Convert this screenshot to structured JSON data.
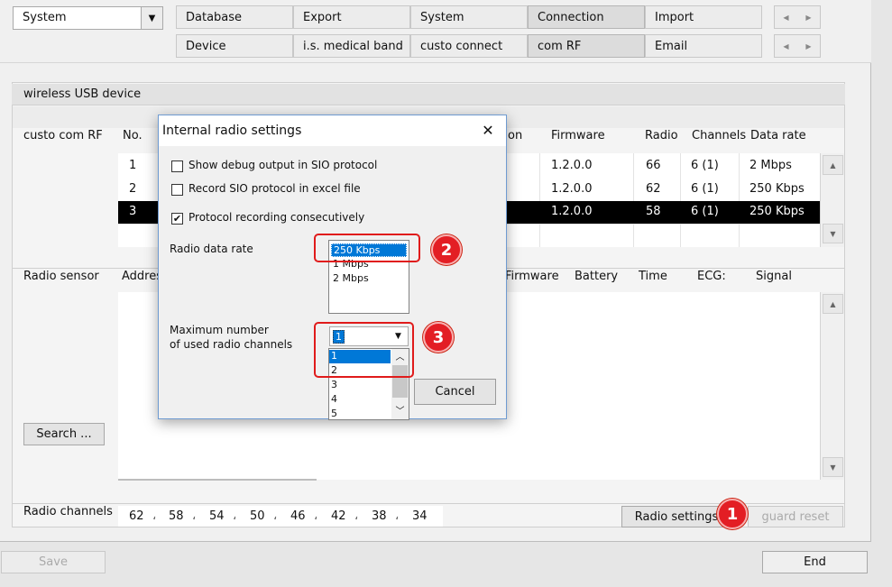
{
  "top": {
    "combo_value": "System",
    "tabs_row1": [
      "Database",
      "Export",
      "System",
      "Connection",
      "Import"
    ],
    "tabs_row2": [
      "Device",
      "i.s. medical band",
      "custo connect",
      "com RF",
      "Email"
    ]
  },
  "section_title": "wireless USB device",
  "device_table": {
    "label": "custo com RF",
    "col_no": "No.",
    "col_on_partial": "on",
    "col_firmware": "Firmware",
    "col_radio": "Radio",
    "col_channels": "Channels",
    "col_datarate": "Data rate",
    "rows": [
      {
        "no": "1",
        "firmware": "1.2.0.0",
        "radio": "66",
        "channels": "6 (1)",
        "rate": "2 Mbps"
      },
      {
        "no": "2",
        "firmware": "1.2.0.0",
        "radio": "62",
        "channels": "6 (1)",
        "rate": "250 Kbps"
      },
      {
        "no": "3",
        "firmware": "1.2.0.0",
        "radio": "58",
        "channels": "6 (1)",
        "rate": "250 Kbps"
      }
    ]
  },
  "sensor_table": {
    "label": "Radio sensor",
    "col_address_partial": "Addres",
    "col_firmware": "Firmware",
    "col_battery": "Battery",
    "col_time": "Time",
    "col_ecg": "ECG:",
    "col_signal": "Signal"
  },
  "search_button": "Search ...",
  "radio_channels": {
    "label": "Radio channels",
    "values": [
      "62",
      "58",
      "54",
      "50",
      "46",
      "42",
      "38",
      "34"
    ]
  },
  "radio_settings_button": "Radio settings",
  "guard_reset_button": "guard reset",
  "save_button": "Save",
  "end_button": "End",
  "dialog": {
    "title": "Internal radio settings",
    "close_glyph": "✕",
    "chk_debug": "Show debug output in SIO protocol",
    "chk_record": "Record SIO protocol in excel file",
    "chk_consecutive": "Protocol recording consecutively",
    "data_rate_label": "Radio data rate",
    "data_rate_options": [
      "250 Kbps",
      "1 Mbps",
      "2 Mbps"
    ],
    "max_channels_label_1": "Maximum number",
    "max_channels_label_2": "of used radio channels",
    "max_channels_value": "1",
    "max_channels_options": [
      "1",
      "2",
      "3",
      "4",
      "5"
    ],
    "cancel_button": "Cancel"
  },
  "badges": [
    "1",
    "2",
    "3"
  ],
  "colors": {
    "callout": "#e01b1b",
    "badge": "#e31e24",
    "selection": "#0078d7",
    "row_selected": "#000000"
  }
}
